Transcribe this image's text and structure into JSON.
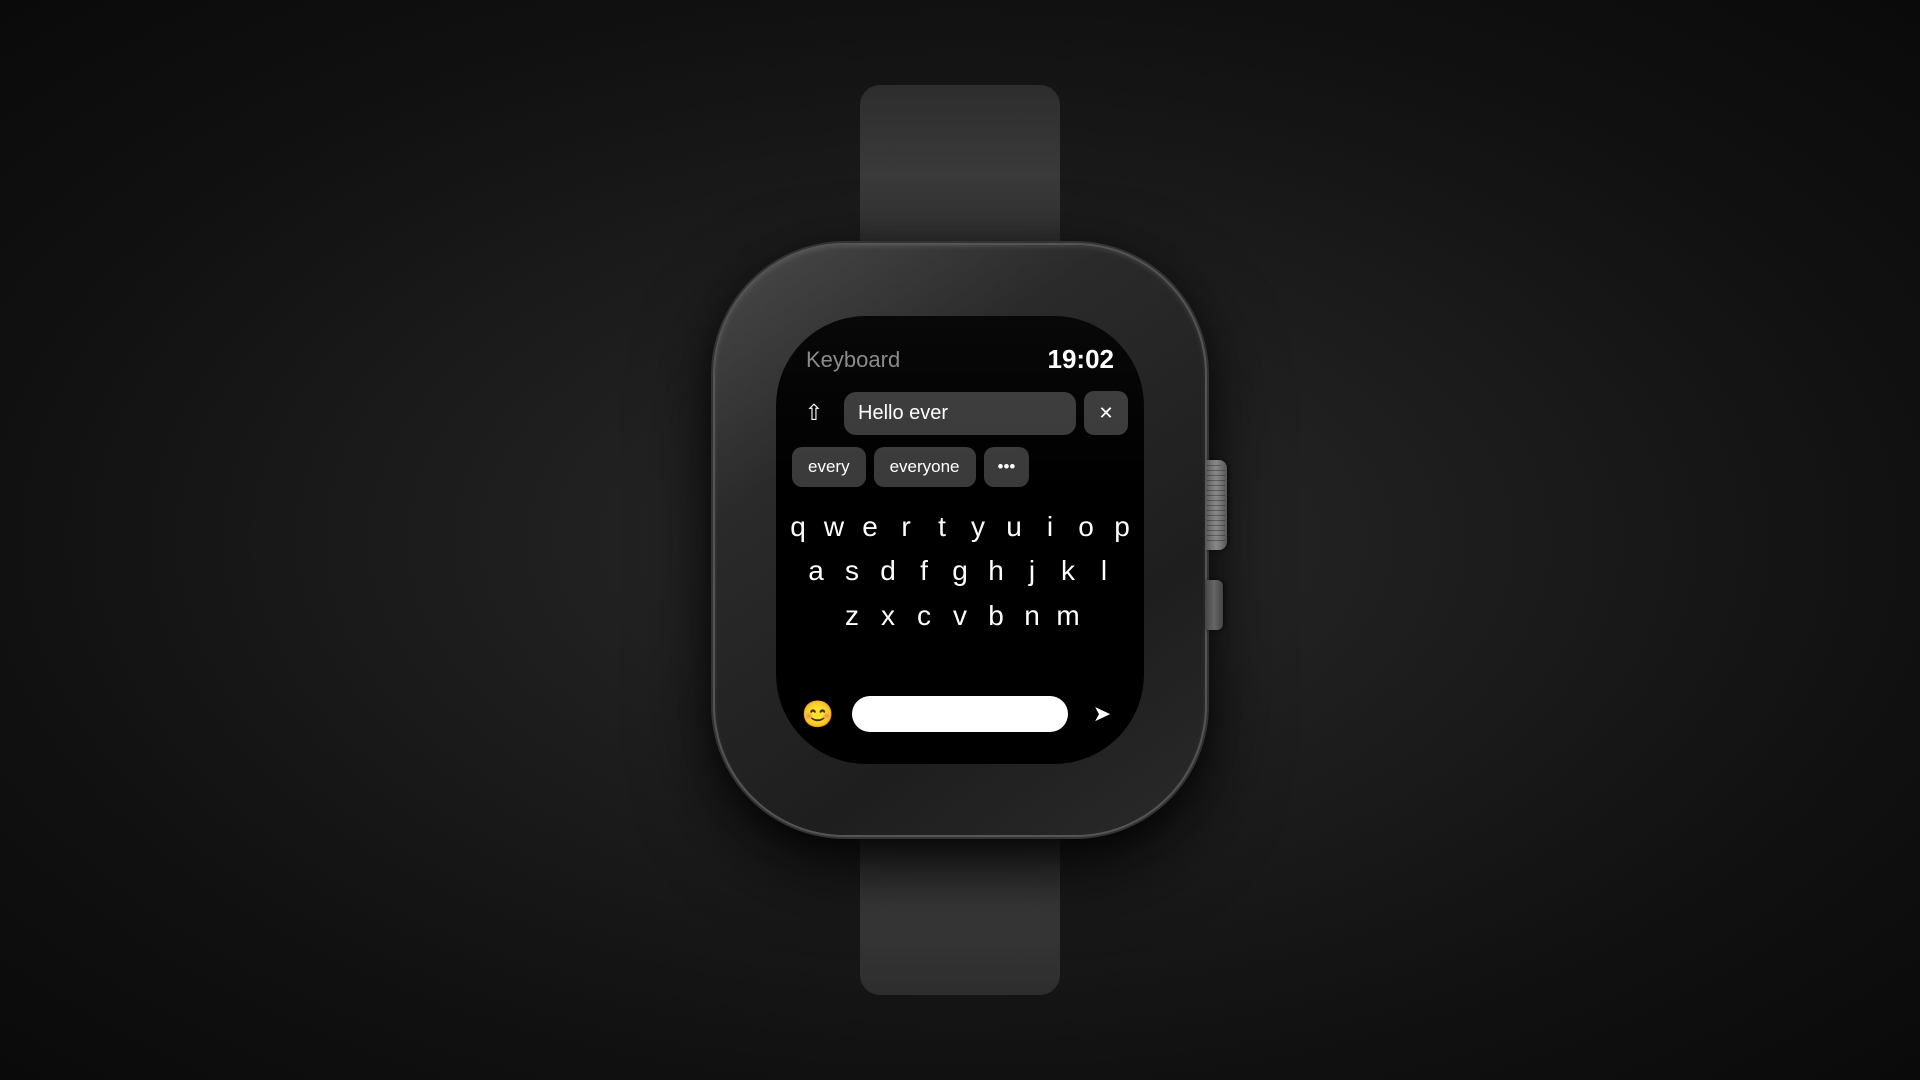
{
  "scene": {
    "background": "#1a1a1a"
  },
  "watch": {
    "header": {
      "title": "Keyboard",
      "time": "19:02"
    },
    "input": {
      "text": "Hello ever",
      "shift_icon": "⇧",
      "backspace_icon": "⌫"
    },
    "autocomplete": {
      "suggestions": [
        "every",
        "everyone",
        "…"
      ]
    },
    "keyboard": {
      "row1": [
        "q",
        "w",
        "e",
        "r",
        "t",
        "y",
        "u",
        "i",
        "o",
        "p"
      ],
      "row2": [
        "a",
        "s",
        "d",
        "f",
        "g",
        "h",
        "j",
        "k",
        "l"
      ],
      "row3": [
        "z",
        "x",
        "c",
        "v",
        "b",
        "n",
        "m"
      ]
    },
    "bottom": {
      "emoji_label": "😊",
      "space_label": "",
      "send_icon": "➤"
    }
  }
}
